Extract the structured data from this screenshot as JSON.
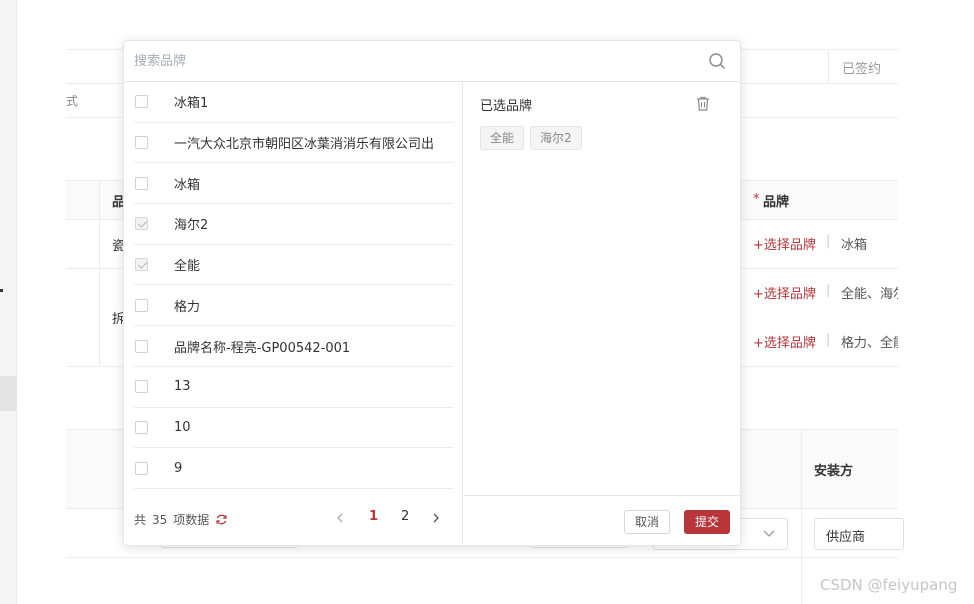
{
  "background": {
    "status_signed": "已签约",
    "partial_method": "式",
    "brand_col_required": "*",
    "brand_col_header": "品牌",
    "partial_col_pin": "品",
    "row1_partial": "瓷",
    "row2_partial": "拆",
    "rows": [
      {
        "action": "+选择品牌",
        "brands": "冰箱"
      },
      {
        "action": "+选择品牌",
        "brands": "全能、海尔"
      },
      {
        "action": "+选择品牌",
        "brands": "格力、全能"
      }
    ],
    "installer_header": "安装方",
    "installer_value": "供应商"
  },
  "modal": {
    "search_placeholder": "搜索品牌",
    "brand_list": [
      {
        "label": "冰箱1",
        "checked": false
      },
      {
        "label": "一汽大众北京市朝阳区冰葉消消乐有限公司出",
        "checked": false
      },
      {
        "label": "冰箱",
        "checked": false
      },
      {
        "label": "海尔2",
        "checked": true
      },
      {
        "label": "全能",
        "checked": true
      },
      {
        "label": "格力",
        "checked": false
      },
      {
        "label": "品牌名称-程亮-GP00542-001",
        "checked": false
      },
      {
        "label": "13",
        "checked": false
      },
      {
        "label": "10",
        "checked": false
      },
      {
        "label": "9",
        "checked": false
      }
    ],
    "pagination": {
      "total_prefix": "共",
      "total_count": "35",
      "total_suffix": "项数据",
      "pages": [
        "1",
        "2"
      ],
      "current_page": "1"
    },
    "selected_title": "已选品牌",
    "selected_tags": [
      "全能",
      "海尔2"
    ],
    "cancel_label": "取消",
    "submit_label": "提交"
  },
  "watermark": "CSDN @feiyupang",
  "colors": {
    "accent": "#b8363a",
    "border": "#e6e6e6",
    "tag_bg": "#f4f4f5"
  }
}
